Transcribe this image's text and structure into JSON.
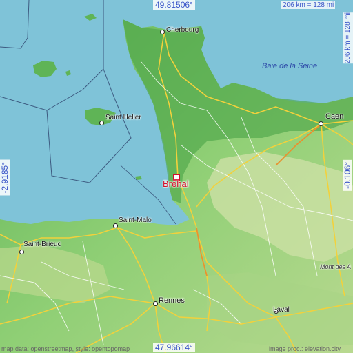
{
  "map": {
    "place_name": "Bréhal",
    "top_latitude": "49.81506°",
    "bottom_latitude": "47.96614°",
    "left_longitude": "-2.9185°",
    "right_longitude": "-0.106°",
    "scale_top": "206 km = 128 mi",
    "scale_right": "206 km = 128 mi",
    "sea_label": "Baie de la Seine",
    "cities": [
      {
        "name": "Cherbourg"
      },
      {
        "name": "Saint Helier"
      },
      {
        "name": "Caen"
      },
      {
        "name": "Saint-Malo"
      },
      {
        "name": "Saint-Brieuc"
      },
      {
        "name": "Rennes"
      },
      {
        "name": "Laval"
      }
    ],
    "region_label": "Mont des A",
    "attribution_left": "map data: openstreetmap, style: opentopomap",
    "attribution_right": "image proc.: elevation.city"
  },
  "colors": {
    "sea": "#7fc3d8",
    "land": "#8fcf75",
    "highland": "#c9dfa2",
    "coast_green": "#4fa64a",
    "marker": "#d3102c",
    "coord_text": "#3a55c8"
  }
}
